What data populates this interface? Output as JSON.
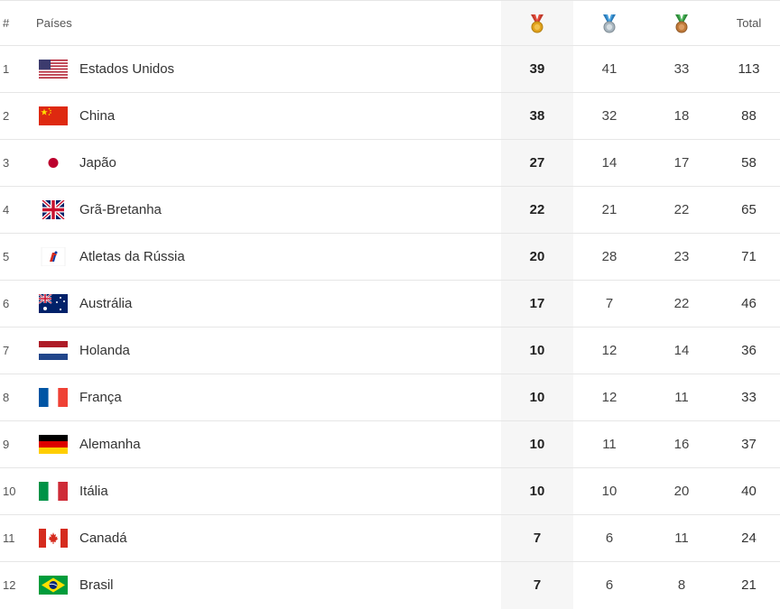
{
  "header": {
    "rank_label": "#",
    "country_label": "Países",
    "gold_icon": "gold-medal-icon",
    "silver_icon": "silver-medal-icon",
    "bronze_icon": "bronze-medal-icon",
    "total_label": "Total"
  },
  "colors": {
    "gold": "#e0a21c",
    "silver": "#a9b6bf",
    "bronze": "#c07a3a",
    "gold_column_bg": "#f6f6f6",
    "row_border": "#e6e6e6"
  },
  "rows": [
    {
      "rank": "1",
      "flag": "usa-flag",
      "country": "Estados Unidos",
      "gold": "39",
      "silver": "41",
      "bronze": "33",
      "total": "113"
    },
    {
      "rank": "2",
      "flag": "china-flag",
      "country": "China",
      "gold": "38",
      "silver": "32",
      "bronze": "18",
      "total": "88"
    },
    {
      "rank": "3",
      "flag": "japan-flag",
      "country": "Japão",
      "gold": "27",
      "silver": "14",
      "bronze": "17",
      "total": "58"
    },
    {
      "rank": "4",
      "flag": "uk-flag",
      "country": "Grã-Bretanha",
      "gold": "22",
      "silver": "21",
      "bronze": "22",
      "total": "65"
    },
    {
      "rank": "5",
      "flag": "roc-flag",
      "country": "Atletas da Rússia",
      "gold": "20",
      "silver": "28",
      "bronze": "23",
      "total": "71"
    },
    {
      "rank": "6",
      "flag": "australia-flag",
      "country": "Austrália",
      "gold": "17",
      "silver": "7",
      "bronze": "22",
      "total": "46"
    },
    {
      "rank": "7",
      "flag": "netherlands-flag",
      "country": "Holanda",
      "gold": "10",
      "silver": "12",
      "bronze": "14",
      "total": "36"
    },
    {
      "rank": "8",
      "flag": "france-flag",
      "country": "França",
      "gold": "10",
      "silver": "12",
      "bronze": "11",
      "total": "33"
    },
    {
      "rank": "9",
      "flag": "germany-flag",
      "country": "Alemanha",
      "gold": "10",
      "silver": "11",
      "bronze": "16",
      "total": "37"
    },
    {
      "rank": "10",
      "flag": "italy-flag",
      "country": "Itália",
      "gold": "10",
      "silver": "10",
      "bronze": "20",
      "total": "40"
    },
    {
      "rank": "11",
      "flag": "canada-flag",
      "country": "Canadá",
      "gold": "7",
      "silver": "6",
      "bronze": "11",
      "total": "24"
    },
    {
      "rank": "12",
      "flag": "brazil-flag",
      "country": "Brasil",
      "gold": "7",
      "silver": "6",
      "bronze": "8",
      "total": "21"
    }
  ]
}
